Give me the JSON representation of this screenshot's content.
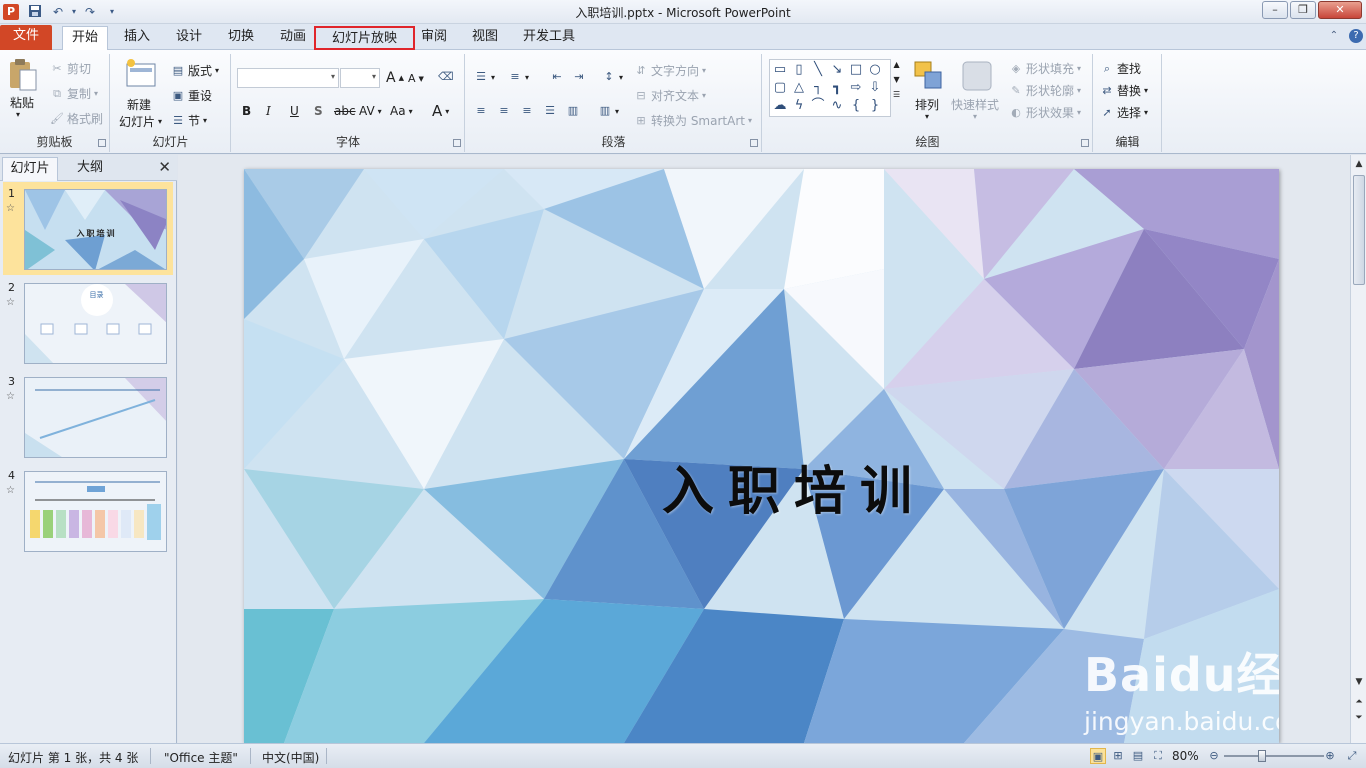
{
  "window": {
    "app_logo": "P",
    "title": "入职培训.pptx - Microsoft PowerPoint",
    "qat_save_icon": "save-icon",
    "qat_undo_icon": "undo-icon",
    "qat_redo_icon": "redo-icon"
  },
  "tabs": [
    {
      "label": "文件"
    },
    {
      "label": "开始"
    },
    {
      "label": "插入"
    },
    {
      "label": "设计"
    },
    {
      "label": "切换"
    },
    {
      "label": "动画"
    },
    {
      "label": "幻灯片放映"
    },
    {
      "label": "审阅"
    },
    {
      "label": "视图"
    },
    {
      "label": "开发工具"
    }
  ],
  "ribbon": {
    "clipboard": {
      "paste": "粘贴",
      "cut": "剪切",
      "copy": "复制",
      "format_painter": "格式刷",
      "label": "剪贴板"
    },
    "slides": {
      "new_slide_1": "新建",
      "new_slide_2": "幻灯片",
      "layout": "版式",
      "reset": "重设",
      "section": "节",
      "label": "幻灯片"
    },
    "font": {
      "label": "字体",
      "bold": "B",
      "italic": "I",
      "underline": "U",
      "shadow": "S",
      "strike": "abc",
      "spacing": "AV",
      "case": "Aa",
      "grow": "A",
      "shrink": "A",
      "color": "A"
    },
    "paragraph": {
      "label": "段落",
      "text_direction": "文字方向",
      "align_text": "对齐文本",
      "smartart": "转换为 SmartArt"
    },
    "drawing": {
      "label": "绘图",
      "arrange": "排列",
      "quick_styles": "快速样式",
      "shape_fill": "形状填充",
      "shape_outline": "形状轮廓",
      "shape_effects": "形状效果"
    },
    "editing": {
      "label": "编辑",
      "find": "查找",
      "replace": "替换",
      "select": "选择"
    }
  },
  "pane": {
    "tab_slides": "幻灯片",
    "tab_outline": "大纲",
    "slides": [
      {
        "num": "1",
        "text": "入职培训"
      },
      {
        "num": "2",
        "text": "目录"
      },
      {
        "num": "3",
        "text": ""
      },
      {
        "num": "4",
        "text": ""
      }
    ]
  },
  "slide": {
    "title": "入职培训",
    "watermark_big": "Baidu经验",
    "watermark_url": "jingyan.baidu.com"
  },
  "status": {
    "slide_info": "幻灯片 第 1 张，共 4 张",
    "theme": "\"Office 主题\"",
    "language": "中文(中国)",
    "zoom": "80%",
    "zoom_level_percent": 80
  }
}
